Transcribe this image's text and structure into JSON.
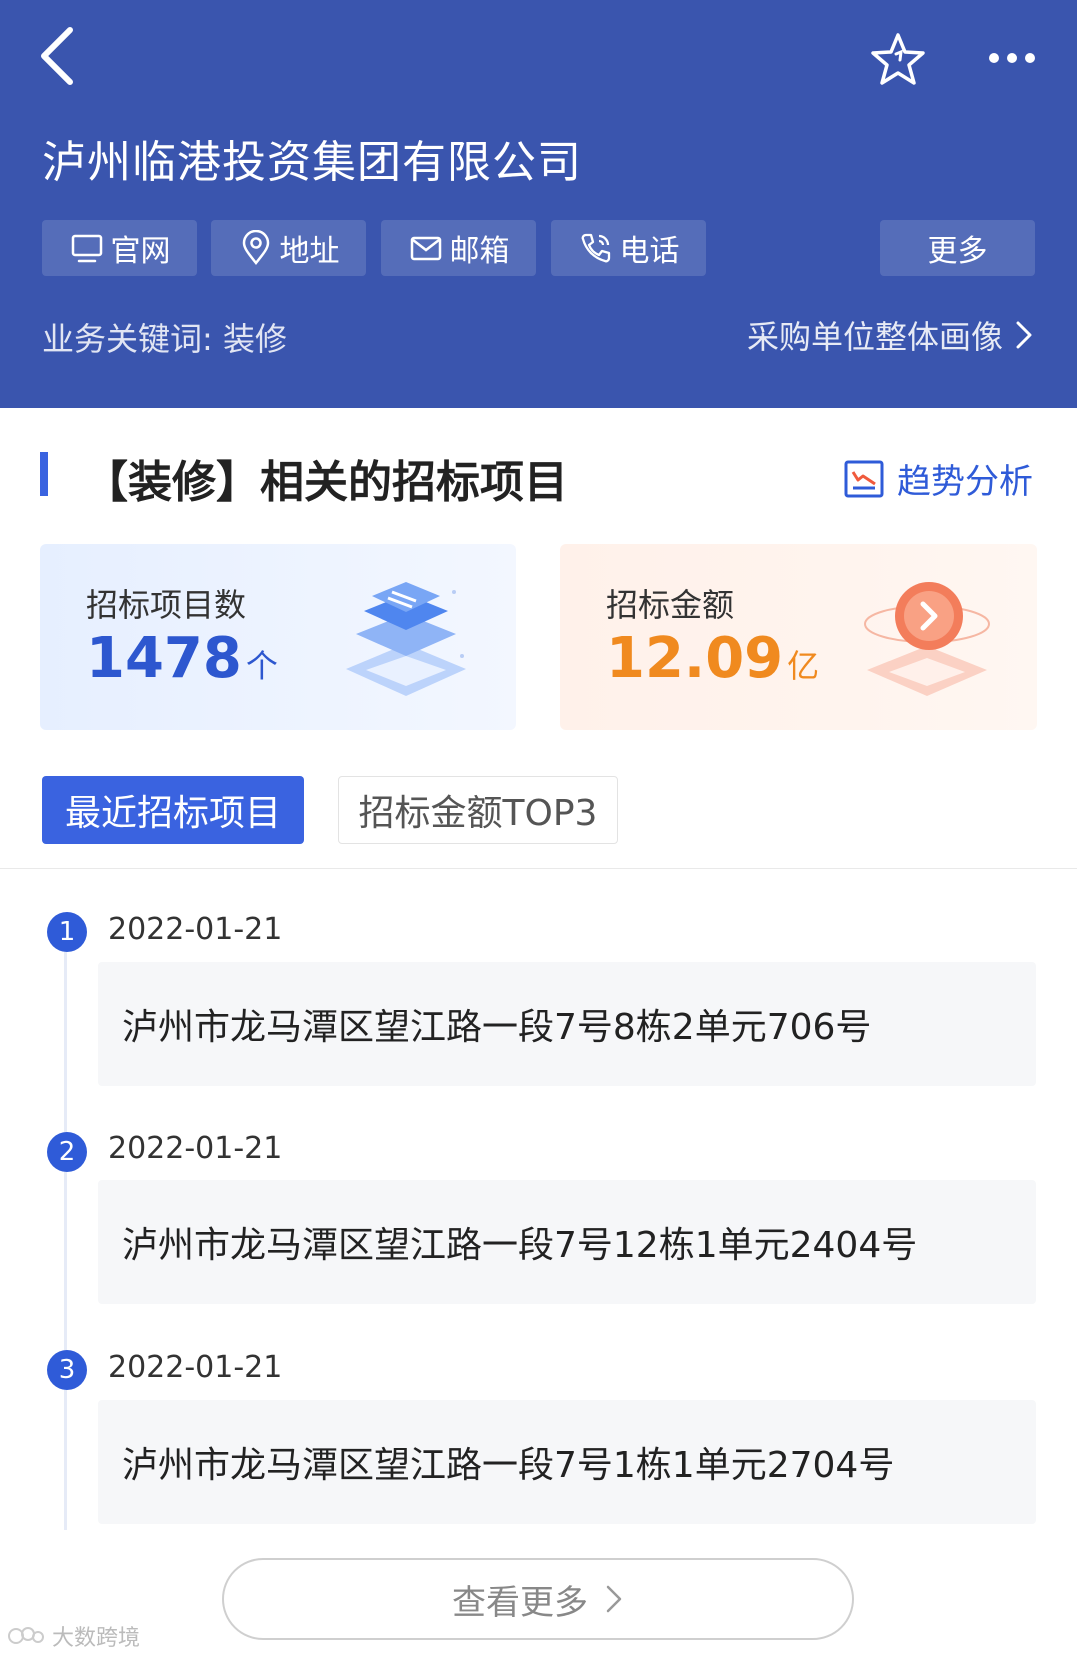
{
  "header": {
    "title": "泸州临港投资集团有限公司",
    "chips": {
      "website": "官网",
      "address": "地址",
      "email": "邮箱",
      "phone": "电话",
      "more": "更多"
    },
    "keywords": "业务关键词: 装修",
    "portrait_link": "采购单位整体画像"
  },
  "section": {
    "title": "【装修】相关的招标项目",
    "trend_link": "趋势分析"
  },
  "stats": {
    "count_label": "招标项目数",
    "count_value": "1478",
    "count_unit": "个",
    "amount_label": "招标金额",
    "amount_value": "12.09",
    "amount_unit": "亿"
  },
  "tabs": {
    "recent": "最近招标项目",
    "top3": "招标金额TOP3"
  },
  "timeline": [
    {
      "index": "1",
      "date": "2022-01-21",
      "title": "泸州市龙马潭区望江路一段7号8栋2单元706号"
    },
    {
      "index": "2",
      "date": "2022-01-21",
      "title": "泸州市龙马潭区望江路一段7号12栋1单元2404号"
    },
    {
      "index": "3",
      "date": "2022-01-21",
      "title": "泸州市龙马潭区望江路一段7号1栋1单元2704号"
    }
  ],
  "view_more": "查看更多",
  "watermark": "大数跨境",
  "colors": {
    "header_bg": "#3a55ae",
    "accent_blue": "#3a63e0",
    "amount_orange": "#f08a1f"
  }
}
